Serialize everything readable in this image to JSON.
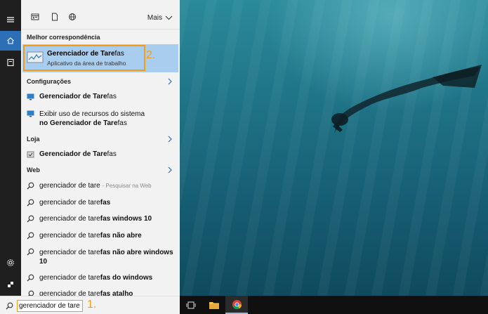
{
  "topbar": {
    "more_label": "Mais"
  },
  "best_match": {
    "heading": "Melhor correspondência",
    "title_prefix": "Gerenciador de Tare",
    "title_suffix": "fas",
    "subtitle": "Aplicativo da área de trabalho",
    "step_label": "2."
  },
  "settings": {
    "heading": "Configurações",
    "items": [
      {
        "prefix": "Gerenciador de Tare",
        "suffix": "fas"
      },
      {
        "line1": "Exibir uso de recursos do sistema",
        "line2_prefix": "no Gerenciador de Tare",
        "line2_suffix": "fas"
      }
    ]
  },
  "store": {
    "heading": "Loja",
    "items": [
      {
        "prefix": "Gerenciador de Tare",
        "suffix": "fas"
      }
    ]
  },
  "web": {
    "heading": "Web",
    "items": [
      {
        "prefix": "gerenciador de tare",
        "bold": "",
        "suffix": "- Pesquisar na Web"
      },
      {
        "prefix": "gerenciador de tare",
        "bold": "fas",
        "suffix": ""
      },
      {
        "prefix": "gerenciador de tare",
        "bold": "fas windows 10",
        "suffix": ""
      },
      {
        "prefix": "gerenciador de tare",
        "bold": "fas não abre",
        "suffix": ""
      },
      {
        "prefix": "gerenciador de tare",
        "bold": "fas não abre windows",
        "line2": "10"
      },
      {
        "prefix": "gerenciador de tare",
        "bold": "fas do windows",
        "suffix": ""
      },
      {
        "prefix": "gerenciador de tare",
        "bold": "fas atalho",
        "suffix": ""
      }
    ]
  },
  "search": {
    "value": "gerenciador de tare",
    "step_label": "1."
  },
  "colors": {
    "accent": "#f39c1a",
    "selected": "#a9cdee",
    "rail_active": "#2d6fb6"
  }
}
